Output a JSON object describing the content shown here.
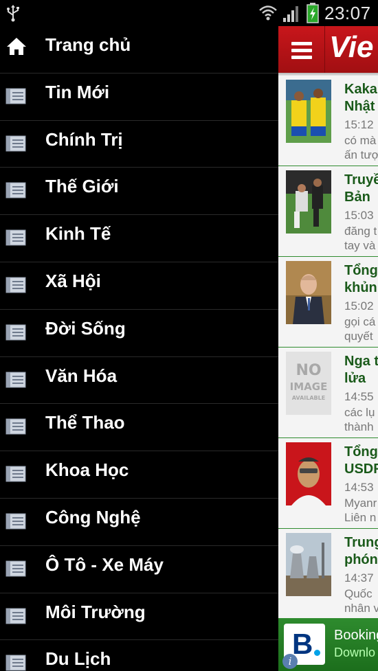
{
  "status_bar": {
    "time": "23:07"
  },
  "drawer": {
    "items": [
      {
        "label": "Trang chủ",
        "icon": "home-icon"
      },
      {
        "label": "Tin Mới",
        "icon": "newspaper-icon"
      },
      {
        "label": "Chính Trị",
        "icon": "newspaper-icon"
      },
      {
        "label": "Thế Giới",
        "icon": "newspaper-icon"
      },
      {
        "label": "Kinh Tế",
        "icon": "newspaper-icon"
      },
      {
        "label": "Xã Hội",
        "icon": "newspaper-icon"
      },
      {
        "label": "Đời Sống",
        "icon": "newspaper-icon"
      },
      {
        "label": "Văn Hóa",
        "icon": "newspaper-icon"
      },
      {
        "label": "Thể Thao",
        "icon": "newspaper-icon"
      },
      {
        "label": "Khoa Học",
        "icon": "newspaper-icon"
      },
      {
        "label": "Công Nghệ",
        "icon": "newspaper-icon"
      },
      {
        "label": "Ô Tô - Xe Máy",
        "icon": "newspaper-icon"
      },
      {
        "label": "Môi Trường",
        "icon": "newspaper-icon"
      },
      {
        "label": "Du Lịch",
        "icon": "newspaper-icon"
      }
    ]
  },
  "app_bar": {
    "logo_text": "Vie",
    "color": "#b5121b"
  },
  "news": [
    {
      "title": "Kaka\nNhật",
      "time": "15:12",
      "summary": "có mà\nấn tượ"
    },
    {
      "title": "Truyề\nBản",
      "time": "15:03",
      "summary": "đăng t\ntay và"
    },
    {
      "title": "Tổng\nkhủn",
      "time": "15:02",
      "summary": "gọi cá\nquyết"
    },
    {
      "title": "Nga t\nlửa",
      "time": "14:55",
      "summary": "các lụ\nthành",
      "thumb_text": [
        "NO",
        "IMAGE",
        "AVAILABLE"
      ]
    },
    {
      "title": "Tổng\nUSDF",
      "time": "14:53",
      "summary": "Myanr\nLiên n"
    },
    {
      "title": "Trung\nphón",
      "time": "14:37",
      "summary": "Quốc\nnhân v"
    }
  ],
  "ad": {
    "title": "Booking",
    "cta": "Downlo",
    "logo_letter": "B",
    "info_glyph": "i"
  },
  "colors": {
    "headline_green": "#1a5a1a",
    "divider_green": "#2e8b2e",
    "brand_red": "#b5121b"
  }
}
